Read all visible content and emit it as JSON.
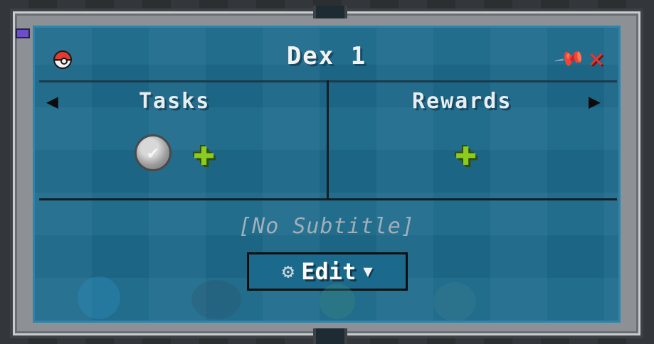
{
  "window": {
    "title": "Dex 1",
    "pin_glyph": "📌",
    "close_glyph": "✕"
  },
  "tasks": {
    "label": "Tasks",
    "check_glyph": "✔"
  },
  "rewards": {
    "label": "Rewards"
  },
  "nav": {
    "left_glyph": "◀",
    "right_glyph": "▶"
  },
  "plus_glyph": "✚",
  "subtitle": "[No Subtitle]",
  "edit_button": {
    "label": "Edit",
    "gear_glyph": "⚙",
    "dropdown_glyph": "▼"
  },
  "colors": {
    "panel": "#1e6a8c",
    "close": "#e23a35",
    "plus": "#8ccc1e"
  },
  "icons": [
    "pokeball-icon",
    "pin-icon",
    "close-icon",
    "arrow-left-icon",
    "arrow-right-icon",
    "checkmark-icon",
    "plus-icon",
    "gear-icon",
    "dropdown-icon"
  ]
}
